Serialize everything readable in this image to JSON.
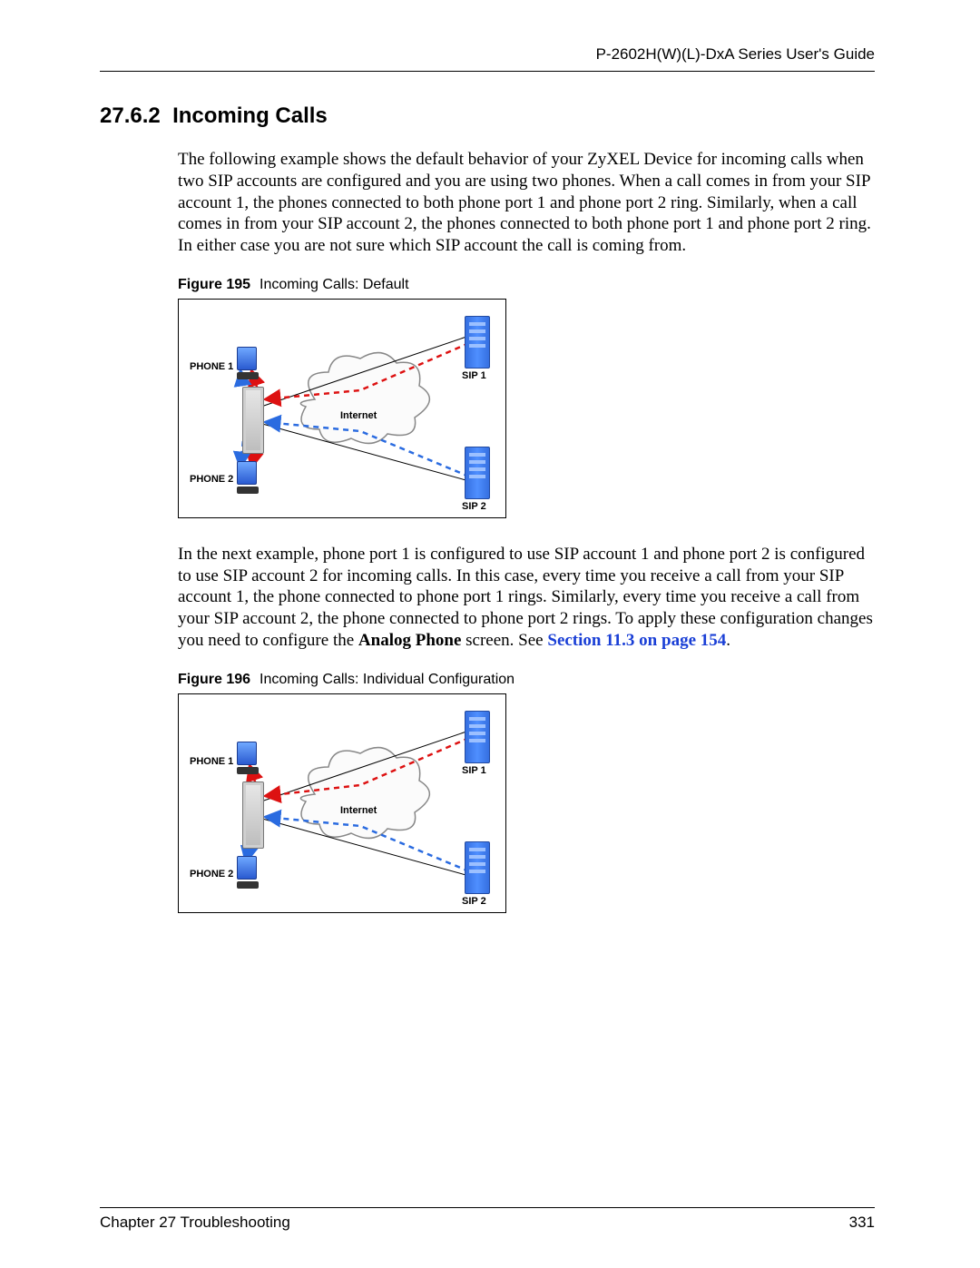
{
  "running_head": "P-2602H(W)(L)-DxA Series User's Guide",
  "section": {
    "number": "27.6.2",
    "title": "Incoming Calls"
  },
  "paragraphs": {
    "p1": "The following example shows the default behavior of your ZyXEL Device for incoming calls when two SIP accounts are configured and you are using two phones. When a call comes in from your SIP account 1, the phones connected to both phone port 1 and phone port 2 ring. Similarly, when a call comes in from your SIP account 2, the phones connected to both phone port 1 and phone port 2 ring. In either case you are not sure which SIP account the call is coming from.",
    "p2_before_bold": "In the next example, phone port 1 is configured to use SIP account 1 and phone port 2 is configured to use SIP account 2 for incoming calls. In this case, every time you receive a call from your SIP account 1, the phone connected to phone port 1 rings. Similarly, every time you receive a call from your SIP account 2, the phone connected to phone port 2 rings. To apply these configuration changes you need to configure the ",
    "p2_bold": "Analog Phone",
    "p2_after_bold": " screen. See ",
    "p2_xref": "Section 11.3 on page 154",
    "p2_end": "."
  },
  "figures": {
    "f195": {
      "label": "Figure 195",
      "caption": "Incoming Calls: Default"
    },
    "f196": {
      "label": "Figure 196",
      "caption": "Incoming Calls: Individual Configuration"
    }
  },
  "diagram_labels": {
    "phone1": "PHONE 1",
    "phone2": "PHONE 2",
    "sip1": "SIP 1",
    "sip2": "SIP 2",
    "internet": "Internet"
  },
  "footer": {
    "left": "Chapter 27 Troubleshooting",
    "right": "331"
  }
}
